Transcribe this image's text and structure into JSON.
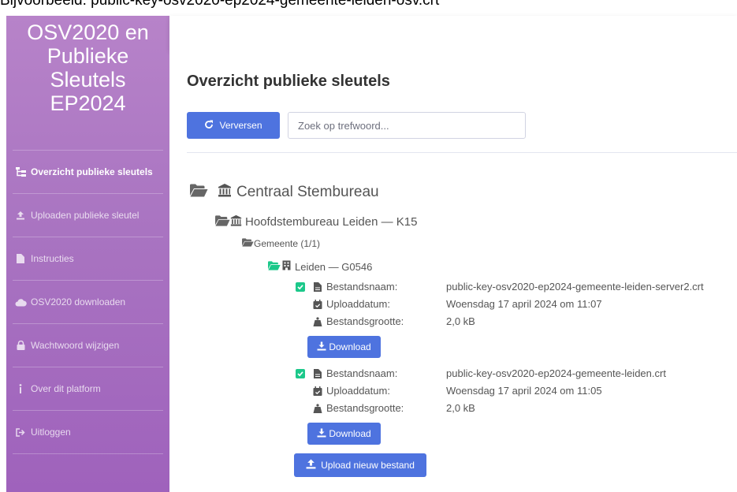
{
  "caption": "Bijvoorbeeld: public-key-osv2020-ep2024-gemeente-leiden-osv.crt",
  "sidebar": {
    "brand_lines": [
      "OSV2020 en",
      "Publieke",
      "Sleutels",
      "EP2024"
    ],
    "items": [
      {
        "label": "Overzicht publieke sleutels",
        "icon": "sitemap-icon",
        "active": true
      },
      {
        "label": "Uploaden publieke sleutel",
        "icon": "upload-icon",
        "active": false
      },
      {
        "label": "Instructies",
        "icon": "file-icon",
        "active": false
      },
      {
        "label": "OSV2020 downloaden",
        "icon": "cloud-download-icon",
        "active": false
      },
      {
        "label": "Wachtwoord wijzigen",
        "icon": "lock-icon",
        "active": false
      },
      {
        "label": "Over dit platform",
        "icon": "info-icon",
        "active": false
      },
      {
        "label": "Uitloggen",
        "icon": "sign-out-icon",
        "active": false
      }
    ]
  },
  "main": {
    "title": "Overzicht publieke sleutels",
    "refresh_label": "Verversen",
    "search_placeholder": "Zoek op trefwoord...",
    "tree": {
      "root": "Centraal Stembureau",
      "hsb": "Hoofdstembureau Leiden — K15",
      "group": "Gemeente (1/1)",
      "municipality": "Leiden — G0546"
    },
    "labels": {
      "filename": "Bestandsnaam:",
      "upload_date": "Uploaddatum:",
      "filesize": "Bestandsgrootte:"
    },
    "files": [
      {
        "filename": "public-key-osv2020-ep2024-gemeente-leiden-server2.crt",
        "upload_date": "Woensdag 17 april 2024 om 11:07",
        "filesize": "2,0 kB",
        "download_label": "Download"
      },
      {
        "filename": "public-key-osv2020-ep2024-gemeente-leiden.crt",
        "upload_date": "Woensdag 17 april 2024 om 11:05",
        "filesize": "2,0 kB",
        "download_label": "Download"
      }
    ],
    "upload_label": "Upload nieuw bestand"
  },
  "colors": {
    "primary": "#4e73df",
    "sidebar_top": "#b783c9",
    "sidebar_bottom": "#9f62bc",
    "folder_green": "#1cc88a",
    "check_green": "#1cc88a"
  }
}
